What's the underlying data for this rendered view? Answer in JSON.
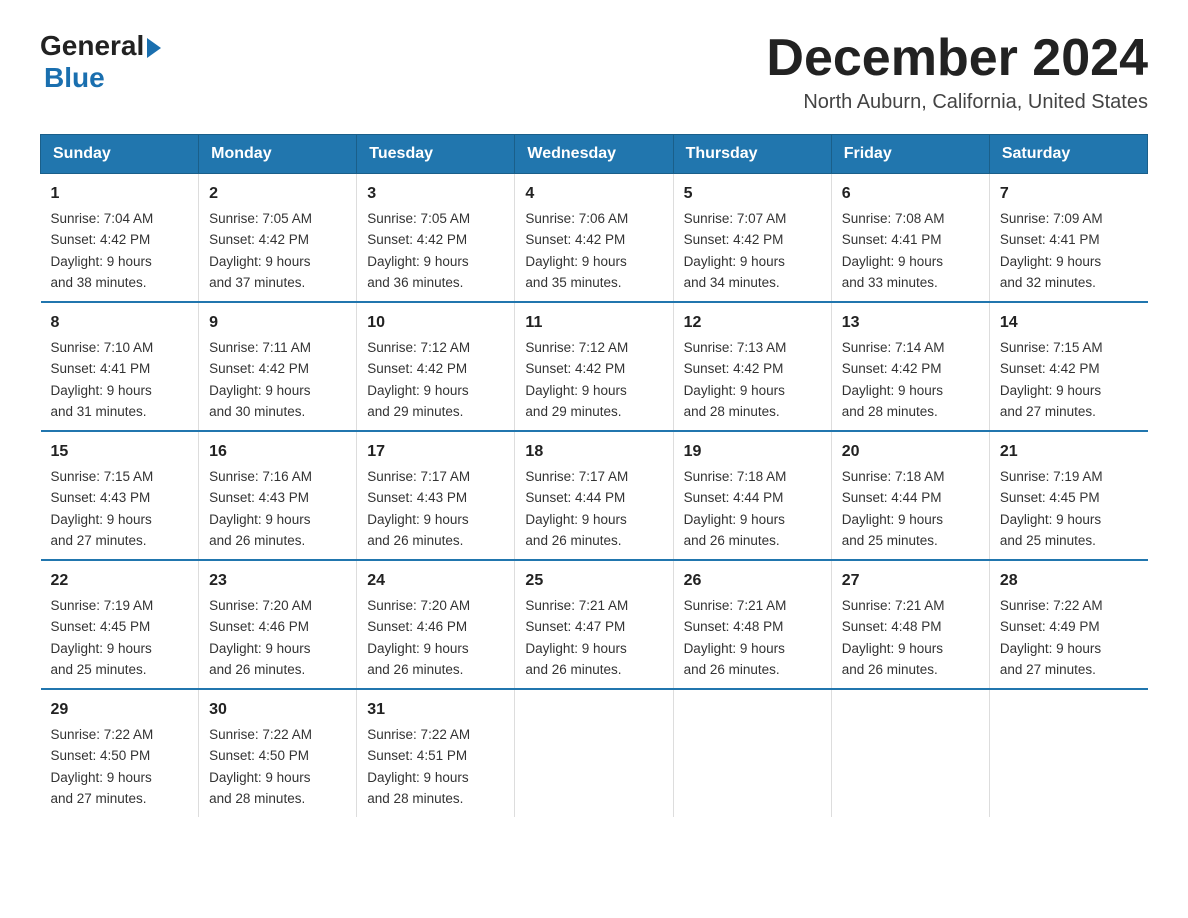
{
  "logo": {
    "general": "General",
    "blue": "Blue"
  },
  "title": "December 2024",
  "subtitle": "North Auburn, California, United States",
  "weekdays": [
    "Sunday",
    "Monday",
    "Tuesday",
    "Wednesday",
    "Thursday",
    "Friday",
    "Saturday"
  ],
  "weeks": [
    [
      {
        "day": "1",
        "sunrise": "7:04 AM",
        "sunset": "4:42 PM",
        "daylight": "9 hours and 38 minutes."
      },
      {
        "day": "2",
        "sunrise": "7:05 AM",
        "sunset": "4:42 PM",
        "daylight": "9 hours and 37 minutes."
      },
      {
        "day": "3",
        "sunrise": "7:05 AM",
        "sunset": "4:42 PM",
        "daylight": "9 hours and 36 minutes."
      },
      {
        "day": "4",
        "sunrise": "7:06 AM",
        "sunset": "4:42 PM",
        "daylight": "9 hours and 35 minutes."
      },
      {
        "day": "5",
        "sunrise": "7:07 AM",
        "sunset": "4:42 PM",
        "daylight": "9 hours and 34 minutes."
      },
      {
        "day": "6",
        "sunrise": "7:08 AM",
        "sunset": "4:41 PM",
        "daylight": "9 hours and 33 minutes."
      },
      {
        "day": "7",
        "sunrise": "7:09 AM",
        "sunset": "4:41 PM",
        "daylight": "9 hours and 32 minutes."
      }
    ],
    [
      {
        "day": "8",
        "sunrise": "7:10 AM",
        "sunset": "4:41 PM",
        "daylight": "9 hours and 31 minutes."
      },
      {
        "day": "9",
        "sunrise": "7:11 AM",
        "sunset": "4:42 PM",
        "daylight": "9 hours and 30 minutes."
      },
      {
        "day": "10",
        "sunrise": "7:12 AM",
        "sunset": "4:42 PM",
        "daylight": "9 hours and 29 minutes."
      },
      {
        "day": "11",
        "sunrise": "7:12 AM",
        "sunset": "4:42 PM",
        "daylight": "9 hours and 29 minutes."
      },
      {
        "day": "12",
        "sunrise": "7:13 AM",
        "sunset": "4:42 PM",
        "daylight": "9 hours and 28 minutes."
      },
      {
        "day": "13",
        "sunrise": "7:14 AM",
        "sunset": "4:42 PM",
        "daylight": "9 hours and 28 minutes."
      },
      {
        "day": "14",
        "sunrise": "7:15 AM",
        "sunset": "4:42 PM",
        "daylight": "9 hours and 27 minutes."
      }
    ],
    [
      {
        "day": "15",
        "sunrise": "7:15 AM",
        "sunset": "4:43 PM",
        "daylight": "9 hours and 27 minutes."
      },
      {
        "day": "16",
        "sunrise": "7:16 AM",
        "sunset": "4:43 PM",
        "daylight": "9 hours and 26 minutes."
      },
      {
        "day": "17",
        "sunrise": "7:17 AM",
        "sunset": "4:43 PM",
        "daylight": "9 hours and 26 minutes."
      },
      {
        "day": "18",
        "sunrise": "7:17 AM",
        "sunset": "4:44 PM",
        "daylight": "9 hours and 26 minutes."
      },
      {
        "day": "19",
        "sunrise": "7:18 AM",
        "sunset": "4:44 PM",
        "daylight": "9 hours and 26 minutes."
      },
      {
        "day": "20",
        "sunrise": "7:18 AM",
        "sunset": "4:44 PM",
        "daylight": "9 hours and 25 minutes."
      },
      {
        "day": "21",
        "sunrise": "7:19 AM",
        "sunset": "4:45 PM",
        "daylight": "9 hours and 25 minutes."
      }
    ],
    [
      {
        "day": "22",
        "sunrise": "7:19 AM",
        "sunset": "4:45 PM",
        "daylight": "9 hours and 25 minutes."
      },
      {
        "day": "23",
        "sunrise": "7:20 AM",
        "sunset": "4:46 PM",
        "daylight": "9 hours and 26 minutes."
      },
      {
        "day": "24",
        "sunrise": "7:20 AM",
        "sunset": "4:46 PM",
        "daylight": "9 hours and 26 minutes."
      },
      {
        "day": "25",
        "sunrise": "7:21 AM",
        "sunset": "4:47 PM",
        "daylight": "9 hours and 26 minutes."
      },
      {
        "day": "26",
        "sunrise": "7:21 AM",
        "sunset": "4:48 PM",
        "daylight": "9 hours and 26 minutes."
      },
      {
        "day": "27",
        "sunrise": "7:21 AM",
        "sunset": "4:48 PM",
        "daylight": "9 hours and 26 minutes."
      },
      {
        "day": "28",
        "sunrise": "7:22 AM",
        "sunset": "4:49 PM",
        "daylight": "9 hours and 27 minutes."
      }
    ],
    [
      {
        "day": "29",
        "sunrise": "7:22 AM",
        "sunset": "4:50 PM",
        "daylight": "9 hours and 27 minutes."
      },
      {
        "day": "30",
        "sunrise": "7:22 AM",
        "sunset": "4:50 PM",
        "daylight": "9 hours and 28 minutes."
      },
      {
        "day": "31",
        "sunrise": "7:22 AM",
        "sunset": "4:51 PM",
        "daylight": "9 hours and 28 minutes."
      },
      null,
      null,
      null,
      null
    ]
  ]
}
